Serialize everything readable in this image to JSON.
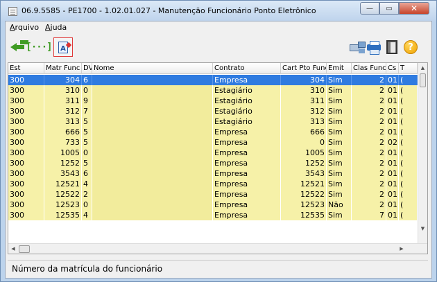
{
  "window": {
    "title": "06.9.5585 - PE1700 - 1.02.01.027 - Manutenção Funcionário Ponto Eletrônico",
    "minimize_glyph": "—",
    "maximize_glyph": "▭",
    "close_glyph": "✕"
  },
  "menu": {
    "items": [
      {
        "accel": "A",
        "rest": "rquivo"
      },
      {
        "accel": "A",
        "rest": "juda"
      }
    ]
  },
  "toolbar": {
    "left": [
      "back-arrow-icon",
      "bracket-icon",
      "document-a-icon"
    ],
    "right": [
      "network-icon",
      "printer-icon",
      "exit-door-icon",
      "help-icon"
    ],
    "bracket_glyph": "[···]",
    "doc_glyph": "A",
    "help_glyph": "?"
  },
  "grid": {
    "columns": [
      "Est",
      "Matr Func",
      "DV",
      "Nome",
      "Contrato",
      "Cart Pto Func",
      "Emit",
      "Clas Func",
      "Cs",
      "T"
    ],
    "rows": [
      {
        "est": "300",
        "matr": "304",
        "dv": "6",
        "nome": "",
        "contrato": "Empresa",
        "cart": "304",
        "emit": "Sim",
        "clas": "2",
        "cs": "01",
        "t": "(",
        "selected": true
      },
      {
        "est": "300",
        "matr": "310",
        "dv": "0",
        "nome": "",
        "contrato": "Estagiário",
        "cart": "310",
        "emit": "Sim",
        "clas": "2",
        "cs": "01",
        "t": "("
      },
      {
        "est": "300",
        "matr": "311",
        "dv": "9",
        "nome": "",
        "contrato": "Estagiário",
        "cart": "311",
        "emit": "Sim",
        "clas": "2",
        "cs": "01",
        "t": "("
      },
      {
        "est": "300",
        "matr": "312",
        "dv": "7",
        "nome": "",
        "contrato": "Estagiário",
        "cart": "312",
        "emit": "Sim",
        "clas": "2",
        "cs": "01",
        "t": "("
      },
      {
        "est": "300",
        "matr": "313",
        "dv": "5",
        "nome": "",
        "contrato": "Estagiário",
        "cart": "313",
        "emit": "Sim",
        "clas": "2",
        "cs": "01",
        "t": "("
      },
      {
        "est": "300",
        "matr": "666",
        "dv": "5",
        "nome": "",
        "contrato": "Empresa",
        "cart": "666",
        "emit": "Sim",
        "clas": "2",
        "cs": "01",
        "t": "("
      },
      {
        "est": "300",
        "matr": "733",
        "dv": "5",
        "nome": "",
        "contrato": "Empresa",
        "cart": "0",
        "emit": "Sim",
        "clas": "2",
        "cs": "02",
        "t": "("
      },
      {
        "est": "300",
        "matr": "1005",
        "dv": "0",
        "nome": "",
        "contrato": "Empresa",
        "cart": "1005",
        "emit": "Sim",
        "clas": "2",
        "cs": "01",
        "t": "("
      },
      {
        "est": "300",
        "matr": "1252",
        "dv": "5",
        "nome": "",
        "contrato": "Empresa",
        "cart": "1252",
        "emit": "Sim",
        "clas": "2",
        "cs": "01",
        "t": "("
      },
      {
        "est": "300",
        "matr": "3543",
        "dv": "6",
        "nome": "",
        "contrato": "Empresa",
        "cart": "3543",
        "emit": "Sim",
        "clas": "2",
        "cs": "01",
        "t": "("
      },
      {
        "est": "300",
        "matr": "12521",
        "dv": "4",
        "nome": "",
        "contrato": "Empresa",
        "cart": "12521",
        "emit": "Sim",
        "clas": "2",
        "cs": "01",
        "t": "("
      },
      {
        "est": "300",
        "matr": "12522",
        "dv": "2",
        "nome": "",
        "contrato": "Empresa",
        "cart": "12522",
        "emit": "Sim",
        "clas": "2",
        "cs": "01",
        "t": "("
      },
      {
        "est": "300",
        "matr": "12523",
        "dv": "0",
        "nome": "",
        "contrato": "Empresa",
        "cart": "12523",
        "emit": "Não",
        "clas": "2",
        "cs": "01",
        "t": "("
      },
      {
        "est": "300",
        "matr": "12535",
        "dv": "4",
        "nome": "",
        "contrato": "Empresa",
        "cart": "12535",
        "emit": "Sim",
        "clas": "7",
        "cs": "01",
        "t": "("
      }
    ]
  },
  "status": {
    "text": "Número da matrícula do funcionário"
  },
  "colors": {
    "row_bg": "#f6f1a8",
    "selected_bg": "#2f7be0"
  }
}
